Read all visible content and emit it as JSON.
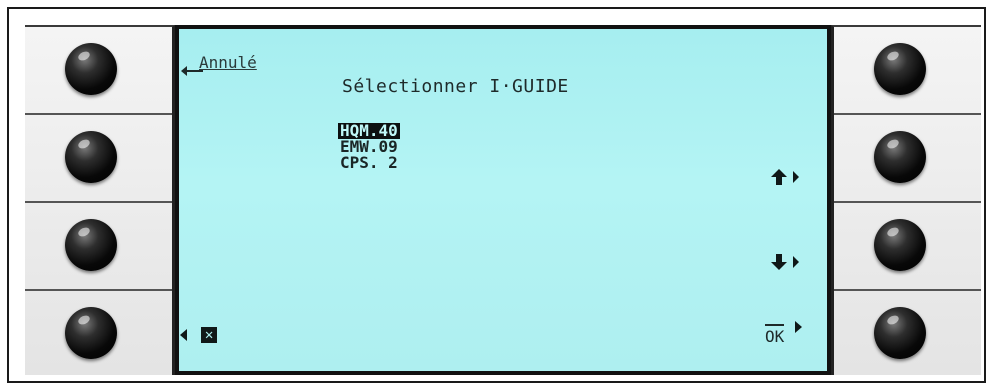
{
  "screen": {
    "cancel_label": "Annulé",
    "title": "Sélectionner I·GUIDE",
    "items": [
      {
        "label": "HQM.40",
        "selected": true
      },
      {
        "label": "EMW.09",
        "selected": false
      },
      {
        "label": "CPS. 2",
        "selected": false
      }
    ],
    "up_arrow_glyph": "🡅",
    "down_arrow_glyph": "🡇",
    "x_glyph": "✕",
    "ok_label": "OK"
  },
  "colors": {
    "screen_bg": "#b4f4f4",
    "text": "#1e2a2a",
    "highlight": "#0c1010"
  }
}
